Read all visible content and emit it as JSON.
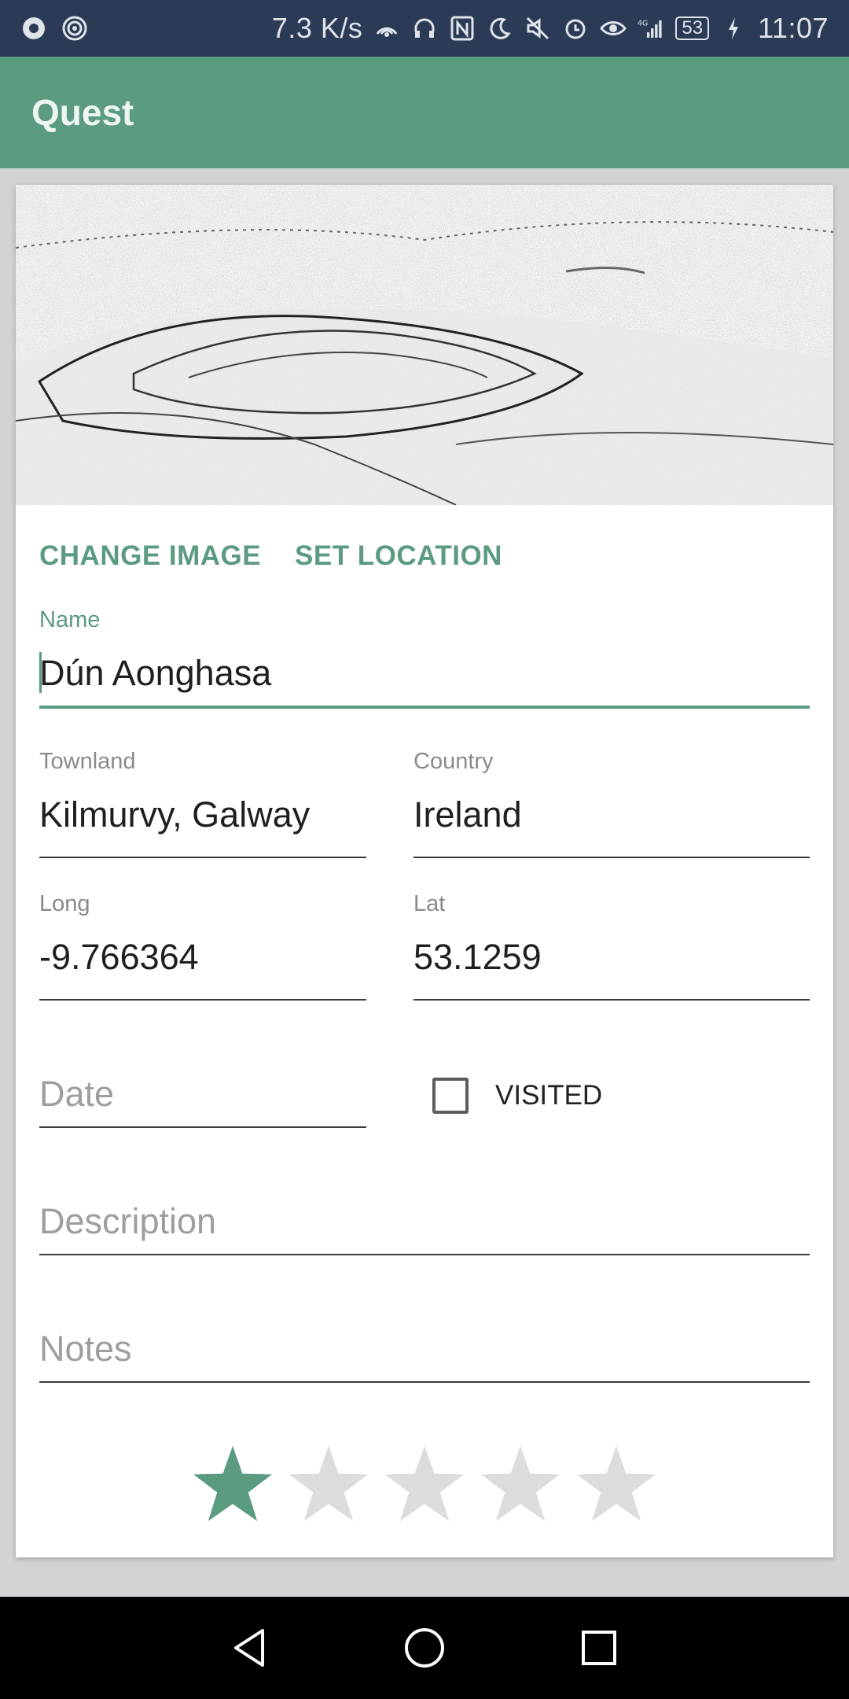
{
  "status_bar": {
    "speed": "7.3 K/s",
    "signal_label": "4G",
    "battery": "53",
    "time": "11:07"
  },
  "app_bar": {
    "title": "Quest"
  },
  "hero": {
    "icon": "landscape-sketch-image"
  },
  "actions": {
    "change_image": "CHANGE IMAGE",
    "set_location": "SET LOCATION"
  },
  "form": {
    "name": {
      "label": "Name",
      "value": "Dún Aonghasa"
    },
    "townland": {
      "label": "Townland",
      "value": "Kilmurvy, Galway"
    },
    "country": {
      "label": "Country",
      "value": "Ireland"
    },
    "long": {
      "label": "Long",
      "value": "-9.766364"
    },
    "lat": {
      "label": "Lat",
      "value": "53.1259"
    },
    "date": {
      "placeholder": "Date"
    },
    "visited": {
      "label": "VISITED",
      "checked": false
    },
    "description": {
      "placeholder": "Description"
    },
    "notes": {
      "placeholder": "Notes"
    }
  },
  "rating": {
    "value": 1,
    "max": 5
  },
  "colors": {
    "accent": "#5b9b7f",
    "status_bar": "#2b3a55",
    "star_empty": "#dcdcdc"
  },
  "nav": {
    "back": "back-icon",
    "home": "home-icon",
    "recents": "recents-icon"
  }
}
